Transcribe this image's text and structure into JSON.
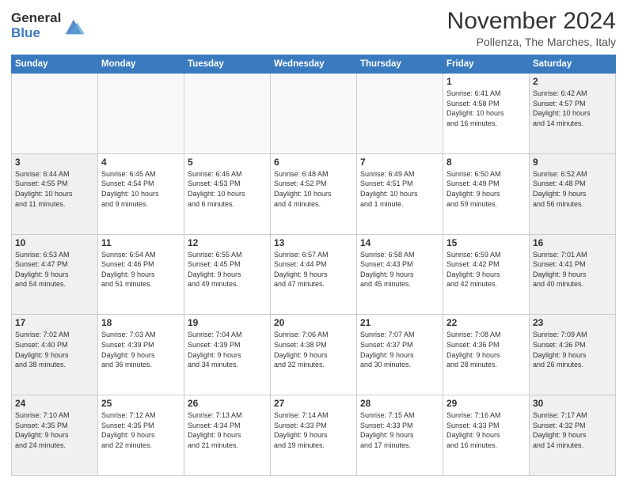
{
  "logo": {
    "general": "General",
    "blue": "Blue"
  },
  "title": "November 2024",
  "location": "Pollenza, The Marches, Italy",
  "weekdays": [
    "Sunday",
    "Monday",
    "Tuesday",
    "Wednesday",
    "Thursday",
    "Friday",
    "Saturday"
  ],
  "weeks": [
    [
      {
        "day": "",
        "type": "empty",
        "info": ""
      },
      {
        "day": "",
        "type": "empty",
        "info": ""
      },
      {
        "day": "",
        "type": "empty",
        "info": ""
      },
      {
        "day": "",
        "type": "empty",
        "info": ""
      },
      {
        "day": "",
        "type": "empty",
        "info": ""
      },
      {
        "day": "1",
        "type": "weekend",
        "info": "Sunrise: 6:41 AM\nSunset: 4:58 PM\nDaylight: 10 hours\nand 16 minutes."
      },
      {
        "day": "2",
        "type": "weekend",
        "info": "Sunrise: 6:42 AM\nSunset: 4:57 PM\nDaylight: 10 hours\nand 14 minutes."
      }
    ],
    [
      {
        "day": "3",
        "type": "weekend",
        "info": "Sunrise: 6:44 AM\nSunset: 4:55 PM\nDaylight: 10 hours\nand 11 minutes."
      },
      {
        "day": "4",
        "type": "weekday",
        "info": "Sunrise: 6:45 AM\nSunset: 4:54 PM\nDaylight: 10 hours\nand 9 minutes."
      },
      {
        "day": "5",
        "type": "weekday",
        "info": "Sunrise: 6:46 AM\nSunset: 4:53 PM\nDaylight: 10 hours\nand 6 minutes."
      },
      {
        "day": "6",
        "type": "weekday",
        "info": "Sunrise: 6:48 AM\nSunset: 4:52 PM\nDaylight: 10 hours\nand 4 minutes."
      },
      {
        "day": "7",
        "type": "weekday",
        "info": "Sunrise: 6:49 AM\nSunset: 4:51 PM\nDaylight: 10 hours\nand 1 minute."
      },
      {
        "day": "8",
        "type": "weekend",
        "info": "Sunrise: 6:50 AM\nSunset: 4:49 PM\nDaylight: 9 hours\nand 59 minutes."
      },
      {
        "day": "9",
        "type": "weekend",
        "info": "Sunrise: 6:52 AM\nSunset: 4:48 PM\nDaylight: 9 hours\nand 56 minutes."
      }
    ],
    [
      {
        "day": "10",
        "type": "weekend",
        "info": "Sunrise: 6:53 AM\nSunset: 4:47 PM\nDaylight: 9 hours\nand 54 minutes."
      },
      {
        "day": "11",
        "type": "weekday",
        "info": "Sunrise: 6:54 AM\nSunset: 4:46 PM\nDaylight: 9 hours\nand 51 minutes."
      },
      {
        "day": "12",
        "type": "weekday",
        "info": "Sunrise: 6:55 AM\nSunset: 4:45 PM\nDaylight: 9 hours\nand 49 minutes."
      },
      {
        "day": "13",
        "type": "weekday",
        "info": "Sunrise: 6:57 AM\nSunset: 4:44 PM\nDaylight: 9 hours\nand 47 minutes."
      },
      {
        "day": "14",
        "type": "weekday",
        "info": "Sunrise: 6:58 AM\nSunset: 4:43 PM\nDaylight: 9 hours\nand 45 minutes."
      },
      {
        "day": "15",
        "type": "weekend",
        "info": "Sunrise: 6:59 AM\nSunset: 4:42 PM\nDaylight: 9 hours\nand 42 minutes."
      },
      {
        "day": "16",
        "type": "weekend",
        "info": "Sunrise: 7:01 AM\nSunset: 4:41 PM\nDaylight: 9 hours\nand 40 minutes."
      }
    ],
    [
      {
        "day": "17",
        "type": "weekend",
        "info": "Sunrise: 7:02 AM\nSunset: 4:40 PM\nDaylight: 9 hours\nand 38 minutes."
      },
      {
        "day": "18",
        "type": "weekday",
        "info": "Sunrise: 7:03 AM\nSunset: 4:39 PM\nDaylight: 9 hours\nand 36 minutes."
      },
      {
        "day": "19",
        "type": "weekday",
        "info": "Sunrise: 7:04 AM\nSunset: 4:39 PM\nDaylight: 9 hours\nand 34 minutes."
      },
      {
        "day": "20",
        "type": "weekday",
        "info": "Sunrise: 7:06 AM\nSunset: 4:38 PM\nDaylight: 9 hours\nand 32 minutes."
      },
      {
        "day": "21",
        "type": "weekday",
        "info": "Sunrise: 7:07 AM\nSunset: 4:37 PM\nDaylight: 9 hours\nand 30 minutes."
      },
      {
        "day": "22",
        "type": "weekend",
        "info": "Sunrise: 7:08 AM\nSunset: 4:36 PM\nDaylight: 9 hours\nand 28 minutes."
      },
      {
        "day": "23",
        "type": "weekend",
        "info": "Sunrise: 7:09 AM\nSunset: 4:36 PM\nDaylight: 9 hours\nand 26 minutes."
      }
    ],
    [
      {
        "day": "24",
        "type": "weekend",
        "info": "Sunrise: 7:10 AM\nSunset: 4:35 PM\nDaylight: 9 hours\nand 24 minutes."
      },
      {
        "day": "25",
        "type": "weekday",
        "info": "Sunrise: 7:12 AM\nSunset: 4:35 PM\nDaylight: 9 hours\nand 22 minutes."
      },
      {
        "day": "26",
        "type": "weekday",
        "info": "Sunrise: 7:13 AM\nSunset: 4:34 PM\nDaylight: 9 hours\nand 21 minutes."
      },
      {
        "day": "27",
        "type": "weekday",
        "info": "Sunrise: 7:14 AM\nSunset: 4:33 PM\nDaylight: 9 hours\nand 19 minutes."
      },
      {
        "day": "28",
        "type": "weekday",
        "info": "Sunrise: 7:15 AM\nSunset: 4:33 PM\nDaylight: 9 hours\nand 17 minutes."
      },
      {
        "day": "29",
        "type": "weekend",
        "info": "Sunrise: 7:16 AM\nSunset: 4:33 PM\nDaylight: 9 hours\nand 16 minutes."
      },
      {
        "day": "30",
        "type": "weekend",
        "info": "Sunrise: 7:17 AM\nSunset: 4:32 PM\nDaylight: 9 hours\nand 14 minutes."
      }
    ]
  ]
}
